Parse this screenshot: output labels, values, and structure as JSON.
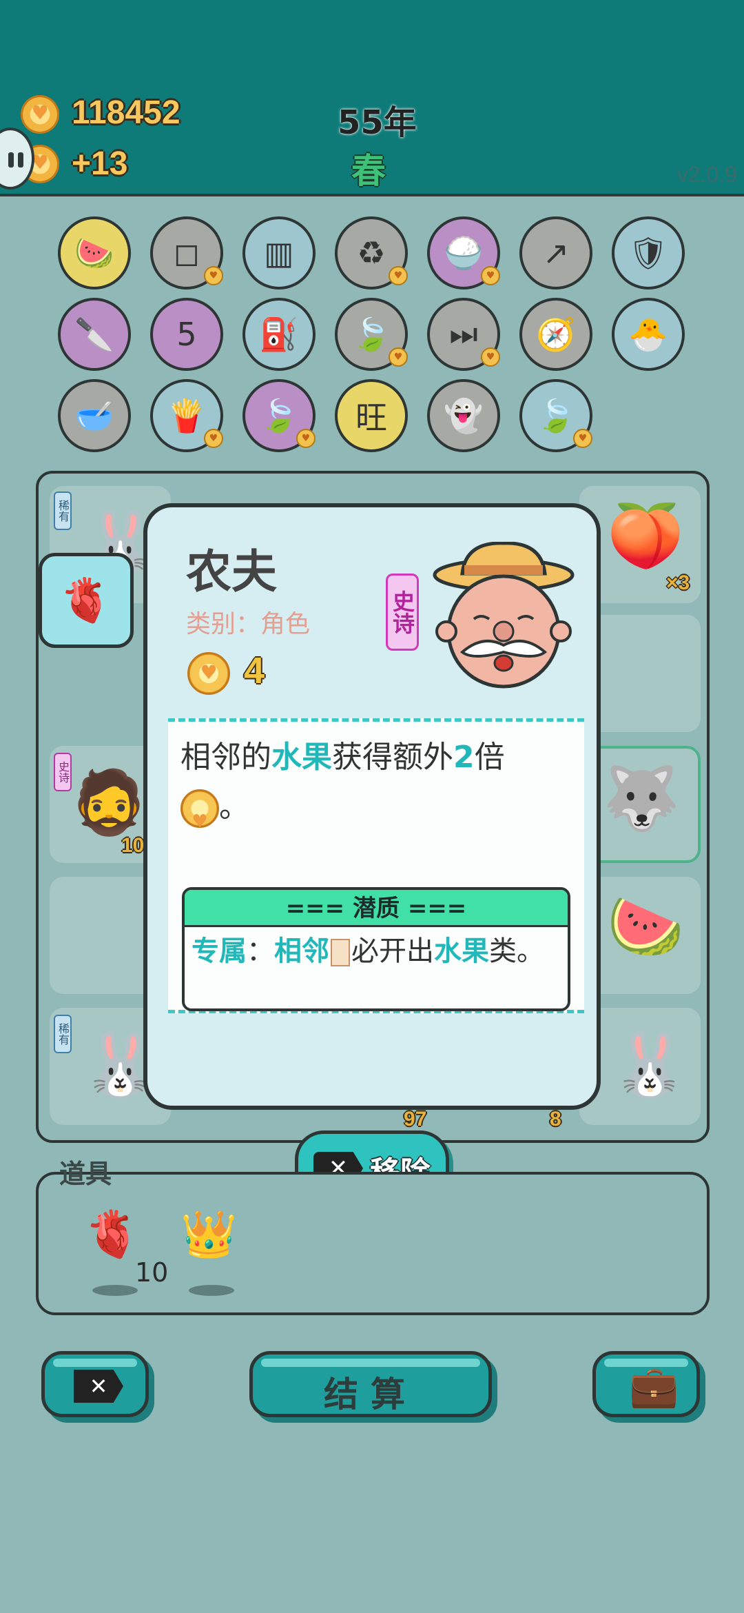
{
  "header": {
    "coins": "118452",
    "income": "+13",
    "year": "55年",
    "season": "春",
    "version": "v2.0.9"
  },
  "relics": [
    {
      "icon": "fruit-basket-icon",
      "glyph": "🍉",
      "color": "yellow"
    },
    {
      "icon": "sugar-cubes-icon",
      "glyph": "◻",
      "color": "gray"
    },
    {
      "icon": "skirt-icon",
      "glyph": "▥",
      "color": "blue"
    },
    {
      "icon": "recycle-icon",
      "glyph": "♻",
      "color": "gray"
    },
    {
      "icon": "rice-bowl-icon",
      "glyph": "🍚",
      "color": "purple"
    },
    {
      "icon": "arrow-card-icon",
      "glyph": "↗",
      "color": "gray"
    },
    {
      "icon": "wrench-shield-icon",
      "glyph": "🛡",
      "color": "blue"
    },
    {
      "icon": "cleaver-icon",
      "glyph": "🔪",
      "color": "purple"
    },
    {
      "icon": "calendar-icon",
      "glyph": "5",
      "color": "purple"
    },
    {
      "icon": "pump-icon",
      "glyph": "⛽",
      "color": "blue"
    },
    {
      "icon": "leaf-icon",
      "glyph": "🍃",
      "color": "gray"
    },
    {
      "icon": "skip-icon",
      "glyph": "⏭",
      "color": "gray"
    },
    {
      "icon": "compass-icon",
      "glyph": "🧭",
      "color": "blue"
    },
    {
      "icon": "chick-egg-icon",
      "glyph": "🐣",
      "color": "blue"
    },
    {
      "icon": "dog-bowl-icon",
      "glyph": "🥣",
      "color": "gray"
    },
    {
      "icon": "fries-icon",
      "glyph": "🍟",
      "color": "blue"
    },
    {
      "icon": "leaf-icon",
      "glyph": "🍃",
      "color": "purple"
    },
    {
      "icon": "wang-tile-icon",
      "glyph": "旺",
      "color": "yellow"
    },
    {
      "icon": "ghost-icon",
      "glyph": "👻",
      "color": "gray"
    },
    {
      "icon": "leaf-icon",
      "glyph": "🍃",
      "color": "blue"
    }
  ],
  "board": {
    "cells": [
      {
        "name": "rabbit",
        "glyph": "🐰",
        "tag": "稀有",
        "count": ""
      },
      {
        "name": "peach",
        "glyph": "🍑",
        "tag": "",
        "count": "×3"
      },
      {
        "name": "bearded-man",
        "glyph": "🧔",
        "tag": "史诗",
        "count": "10"
      },
      {
        "name": "husky",
        "glyph": "🐺",
        "tag": "",
        "count": ""
      },
      {
        "name": "watermelon",
        "glyph": "🍉",
        "tag": "",
        "count": ""
      },
      {
        "name": "rabbit",
        "glyph": "🐰",
        "tag": "稀有",
        "count": ""
      },
      {
        "name": "rabbit",
        "glyph": "🐰",
        "tag": "",
        "count": ""
      }
    ],
    "bottom_counts": [
      "97",
      "8"
    ]
  },
  "hover_item": {
    "icon": "liver-icon",
    "glyph": "🫀"
  },
  "detail": {
    "name": "农夫",
    "category": "类别：角色",
    "rarity": "史诗",
    "cost": "4",
    "desc_part1": "相邻的",
    "desc_hl1": "水果",
    "desc_part2": "获得额外",
    "desc_hl2": "2",
    "desc_part3": "倍",
    "desc_tail": "。",
    "potential_title": "=== 潜质 ===",
    "potential_label": "专属",
    "potential_colon": "：",
    "potential_hl1": "相邻",
    "potential_mid": "必开出",
    "potential_hl2": "水果",
    "potential_end": "类。"
  },
  "remove_button": {
    "label": "移除"
  },
  "items": {
    "title": "道具",
    "list": [
      {
        "icon": "liver-icon",
        "glyph": "🫀",
        "count": "10"
      },
      {
        "icon": "crown-icon",
        "glyph": "👑",
        "count": ""
      }
    ]
  },
  "footer": {
    "settle_label": "结算"
  },
  "colors": {
    "top_bar": "#0e7b79",
    "background": "#8fb8b6",
    "accent": "#2fc3c0",
    "highlight_text": "#22b8b9",
    "epic": "#d03ab8"
  }
}
